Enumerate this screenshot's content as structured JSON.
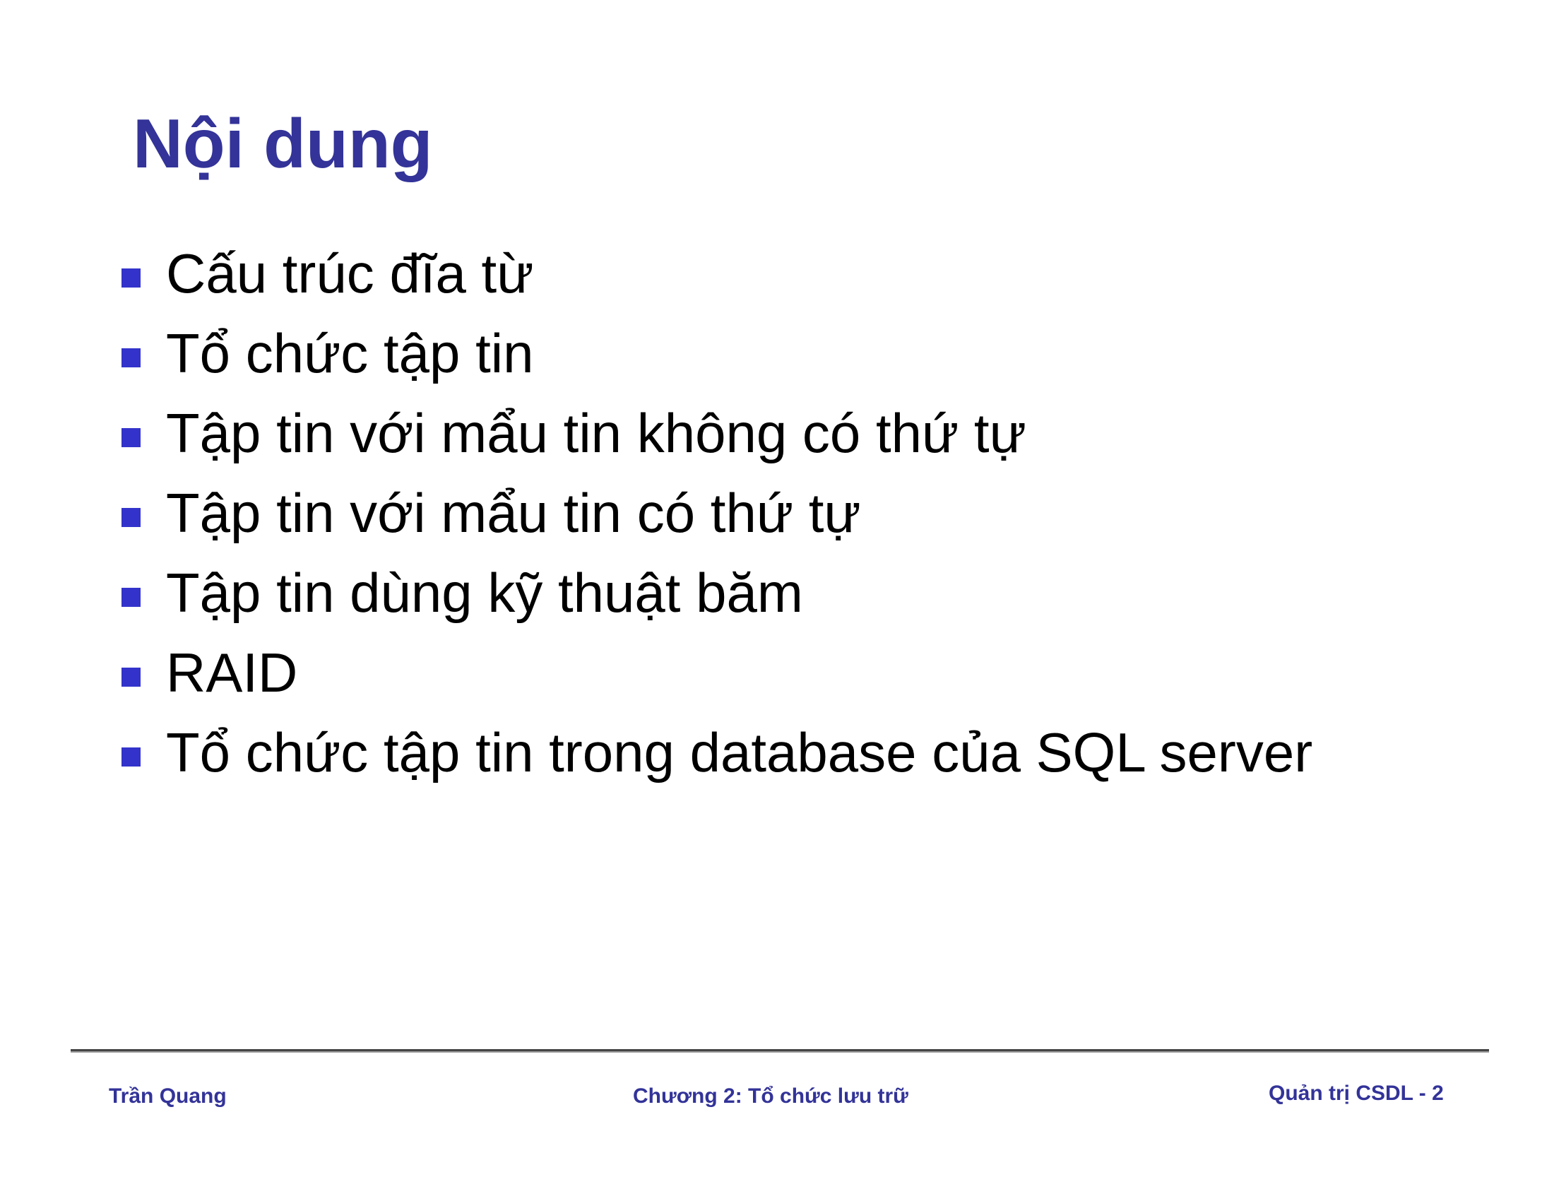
{
  "slide": {
    "title": "Nội dung",
    "bullets": [
      "Cấu trúc đĩa từ",
      "Tổ chức tập tin",
      "Tập tin với mẩu tin không có thứ tự",
      "Tập tin với mẩu tin có thứ tự",
      "Tập tin dùng kỹ thuật băm",
      "RAID",
      "Tổ chức tập tin trong database của SQL server"
    ]
  },
  "footer": {
    "author": "Trần Quang",
    "chapter": "Chương 2: Tổ chức lưu trữ",
    "page": "Quản trị CSDL - 2"
  },
  "colors": {
    "title": "#333399",
    "bullet_marker": "#3333cc",
    "footer_text": "#333399",
    "footer_rule": "#444444"
  }
}
